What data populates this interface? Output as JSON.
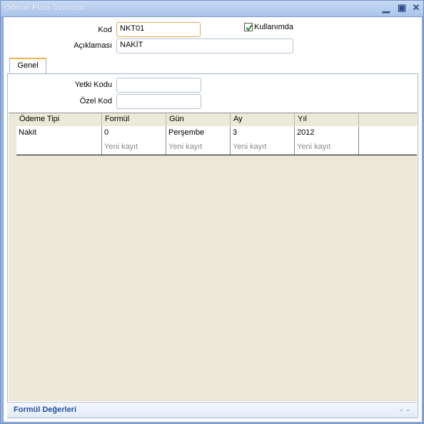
{
  "window": {
    "title": "Ödeme Planı Tanımları"
  },
  "form": {
    "kod_label": "Kod",
    "kod_value": "NKT01",
    "aciklama_label": "Açıklaması",
    "aciklama_value": "NAKİT",
    "kullanimda_label": "Kullanımda",
    "kullanimda_checked": true
  },
  "tabs": [
    {
      "label": "Genel"
    }
  ],
  "genel": {
    "yetki_label": "Yetki Kodu",
    "yetki_value": "",
    "ozel_label": "Özel Kod",
    "ozel_value": ""
  },
  "grid": {
    "columns": [
      "Ödeme Tipi",
      "Formül",
      "Gün",
      "Ay",
      "Yıl"
    ],
    "rows": [
      {
        "odeme_tipi": "Nakit",
        "formul": "0",
        "gun": "Perşembe",
        "ay": "3",
        "yil": "2012"
      }
    ],
    "new_row": {
      "formul": "Yeni kayıt",
      "gun": "Yeni kayıt",
      "ay": "Yeni kayıt",
      "yil": "Yeni kayıt"
    }
  },
  "footer": {
    "label": "Formül Değerleri",
    "icon": "double-chevron-down-icon"
  }
}
